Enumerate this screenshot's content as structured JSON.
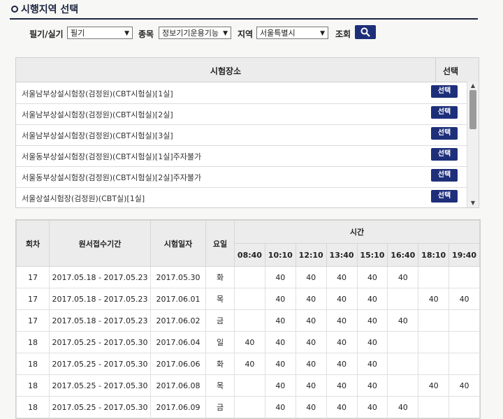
{
  "title": "시행지역 선택",
  "filters": {
    "written_label": "필기/실기",
    "written_value": "필기",
    "category_label": "종목",
    "category_value": "정보기기운용기능",
    "region_label": "지역",
    "region_value": "서울특별시",
    "search_label": "조회"
  },
  "sites": {
    "header_name": "시험장소",
    "header_select": "선택",
    "button_label": "선택",
    "rows": [
      "서울남부상설시험장(검정원)(CBT시험실)[1실]",
      "서울남부상설시험장(검정원)(CBT시험실)[2실]",
      "서울남부상설시험장(검정원)(CBT시험실)[3실]",
      "서울동부상설시험장(검정원)(CBT시험실)[1실]주자불가",
      "서울동부상설시험장(검정원)(CBT시험실)[2실]주자불가",
      "서울상설시험장(검정원)(CBT실)[1실]"
    ]
  },
  "schedule": {
    "headers": {
      "round": "회차",
      "period": "원서접수기간",
      "date": "시험일자",
      "day": "요일",
      "time": "시간"
    },
    "times": [
      "08:40",
      "10:10",
      "12:10",
      "13:40",
      "15:10",
      "16:40",
      "18:10",
      "19:40"
    ],
    "rows": [
      {
        "round": "17",
        "period": "2017.05.18 - 2017.05.23",
        "date": "2017.05.30",
        "day": "화",
        "slots": [
          "",
          "40",
          "40",
          "40",
          "40",
          "40",
          "",
          ""
        ]
      },
      {
        "round": "17",
        "period": "2017.05.18 - 2017.05.23",
        "date": "2017.06.01",
        "day": "목",
        "slots": [
          "",
          "40",
          "40",
          "40",
          "40",
          "",
          "40",
          "40"
        ]
      },
      {
        "round": "17",
        "period": "2017.05.18 - 2017.05.23",
        "date": "2017.06.02",
        "day": "금",
        "slots": [
          "",
          "40",
          "40",
          "40",
          "40",
          "40",
          "",
          ""
        ]
      },
      {
        "round": "18",
        "period": "2017.05.25 - 2017.05.30",
        "date": "2017.06.04",
        "day": "일",
        "slots": [
          "40",
          "40",
          "40",
          "40",
          "40",
          "",
          "",
          ""
        ]
      },
      {
        "round": "18",
        "period": "2017.05.25 - 2017.05.30",
        "date": "2017.06.06",
        "day": "화",
        "slots": [
          "40",
          "40",
          "40",
          "40",
          "40",
          "",
          "",
          ""
        ]
      },
      {
        "round": "18",
        "period": "2017.05.25 - 2017.05.30",
        "date": "2017.06.08",
        "day": "목",
        "slots": [
          "",
          "40",
          "40",
          "40",
          "40",
          "",
          "40",
          "40"
        ]
      },
      {
        "round": "18",
        "period": "2017.05.25 - 2017.05.30",
        "date": "2017.06.09",
        "day": "금",
        "slots": [
          "",
          "40",
          "40",
          "40",
          "40",
          "40",
          "",
          ""
        ]
      }
    ]
  }
}
